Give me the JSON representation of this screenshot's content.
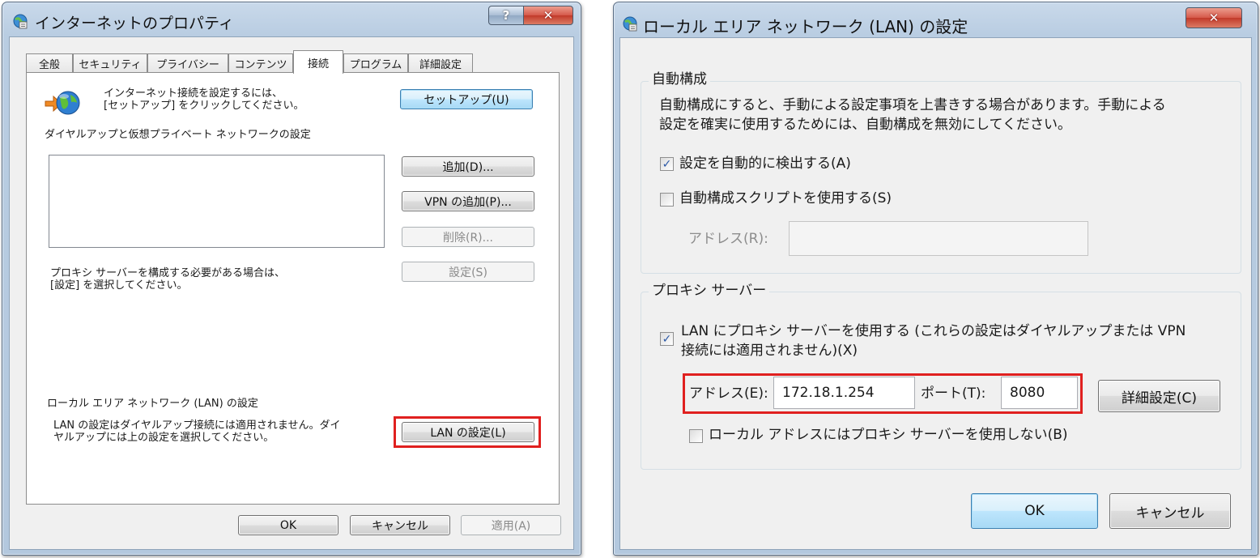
{
  "left_window": {
    "title": "インターネットのプロパティ",
    "help_icon": "question-mark",
    "close_icon": "x",
    "tabs": [
      "全般",
      "セキュリティ",
      "プライバシー",
      "コンテンツ",
      "接続",
      "プログラム",
      "詳細設定"
    ],
    "active_tab": "接続",
    "setup_text_line1": "インターネット接続を設定するには、",
    "setup_text_line2": "[セットアップ] をクリックしてください。",
    "setup_button": "セットアップ(U)",
    "dialup_section_title": "ダイヤルアップと仮想プライベート ネットワークの設定",
    "add_button": "追加(D)...",
    "add_vpn_button": "VPN の追加(P)...",
    "remove_button": "削除(R)...",
    "settings_button": "設定(S)",
    "proxy_hint_line1": "プロキシ サーバーを構成する必要がある場合は、",
    "proxy_hint_line2": "[設定] を選択してください。",
    "lan_section_title": "ローカル エリア ネットワーク (LAN) の設定",
    "lan_hint_line1": "LAN の設定はダイヤルアップ接続には適用されません。ダイ",
    "lan_hint_line2": "ヤルアップには上の設定を選択してください。",
    "lan_settings_button": "LAN の設定(L)",
    "ok_button": "OK",
    "cancel_button": "キャンセル",
    "apply_button": "適用(A)"
  },
  "right_window": {
    "title": "ローカル エリア ネットワーク (LAN) の設定",
    "close_icon": "x",
    "auto_config": {
      "title": "自動構成",
      "description_line1": "自動構成にすると、手動による設定事項を上書きする場合があります。手動による",
      "description_line2": "設定を確実に使用するためには、自動構成を無効にしてください。",
      "auto_detect_label": "設定を自動的に検出する(A)",
      "auto_detect_checked": true,
      "use_script_label": "自動構成スクリプトを使用する(S)",
      "use_script_checked": false,
      "address_label": "アドレス(R):",
      "address_value": ""
    },
    "proxy": {
      "title": "プロキシ サーバー",
      "use_proxy_label_line1": "LAN にプロキシ サーバーを使用する (これらの設定はダイヤルアップまたは VPN",
      "use_proxy_label_line2": "接続には適用されません)(X)",
      "use_proxy_checked": true,
      "address_label": "アドレス(E):",
      "address_value": "172.18.1.254",
      "port_label": "ポート(T):",
      "port_value": "8080",
      "advanced_button": "詳細設定(C)",
      "bypass_local_label": "ローカル アドレスにはプロキシ サーバーを使用しない(B)",
      "bypass_local_checked": false
    },
    "ok_button": "OK",
    "cancel_button": "キャンセル"
  },
  "colors": {
    "highlight": "#e0201f",
    "window_frame": "#b9cde2",
    "dialog_bg": "#f0f0f0"
  }
}
